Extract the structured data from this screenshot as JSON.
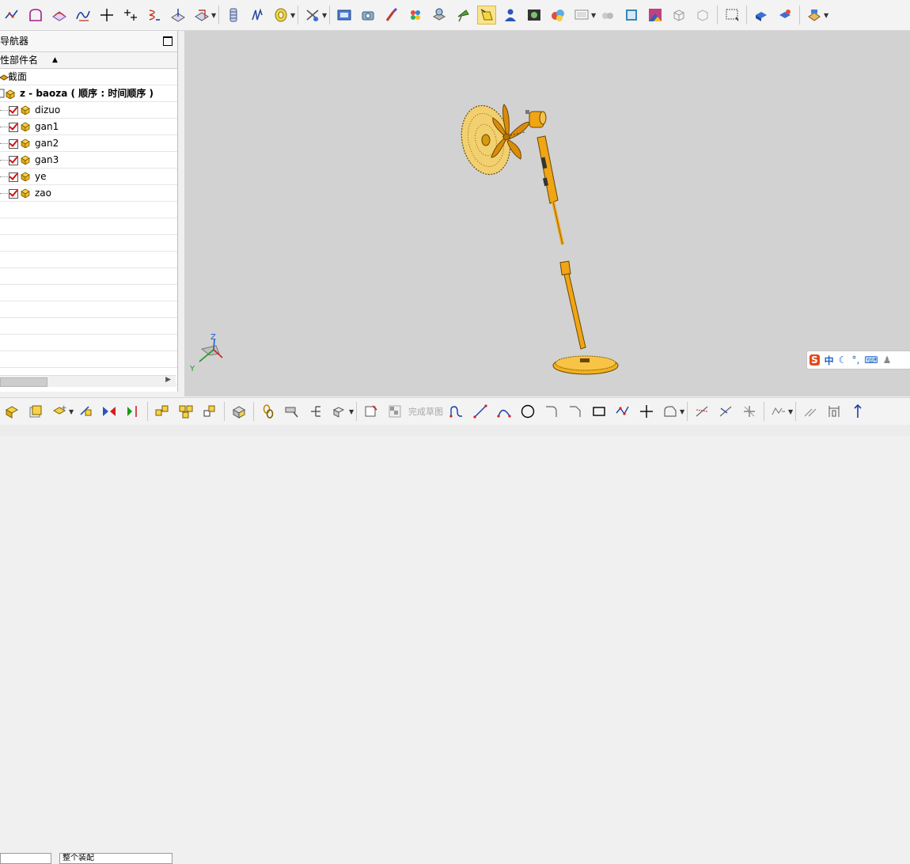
{
  "nav": {
    "title": "导航器",
    "column_header": "性部件名",
    "section_item": "截面",
    "root_item": "z - baoza ( 顺序 : 时间顺序 )",
    "items": [
      "dizuo",
      "gan1",
      "gan2",
      "gan3",
      "ye",
      "zao"
    ]
  },
  "bottom_toolbar": {
    "finish_sketch_label": "完成草图"
  },
  "bottom_strip": {
    "field_value": "整个装配"
  },
  "viewport": {
    "axis_z": "Z",
    "axis_y": "Y",
    "background_color": "#d2d2d2",
    "part_color": "#f0a515"
  },
  "ime": {
    "logo": "S",
    "mode": "中"
  }
}
